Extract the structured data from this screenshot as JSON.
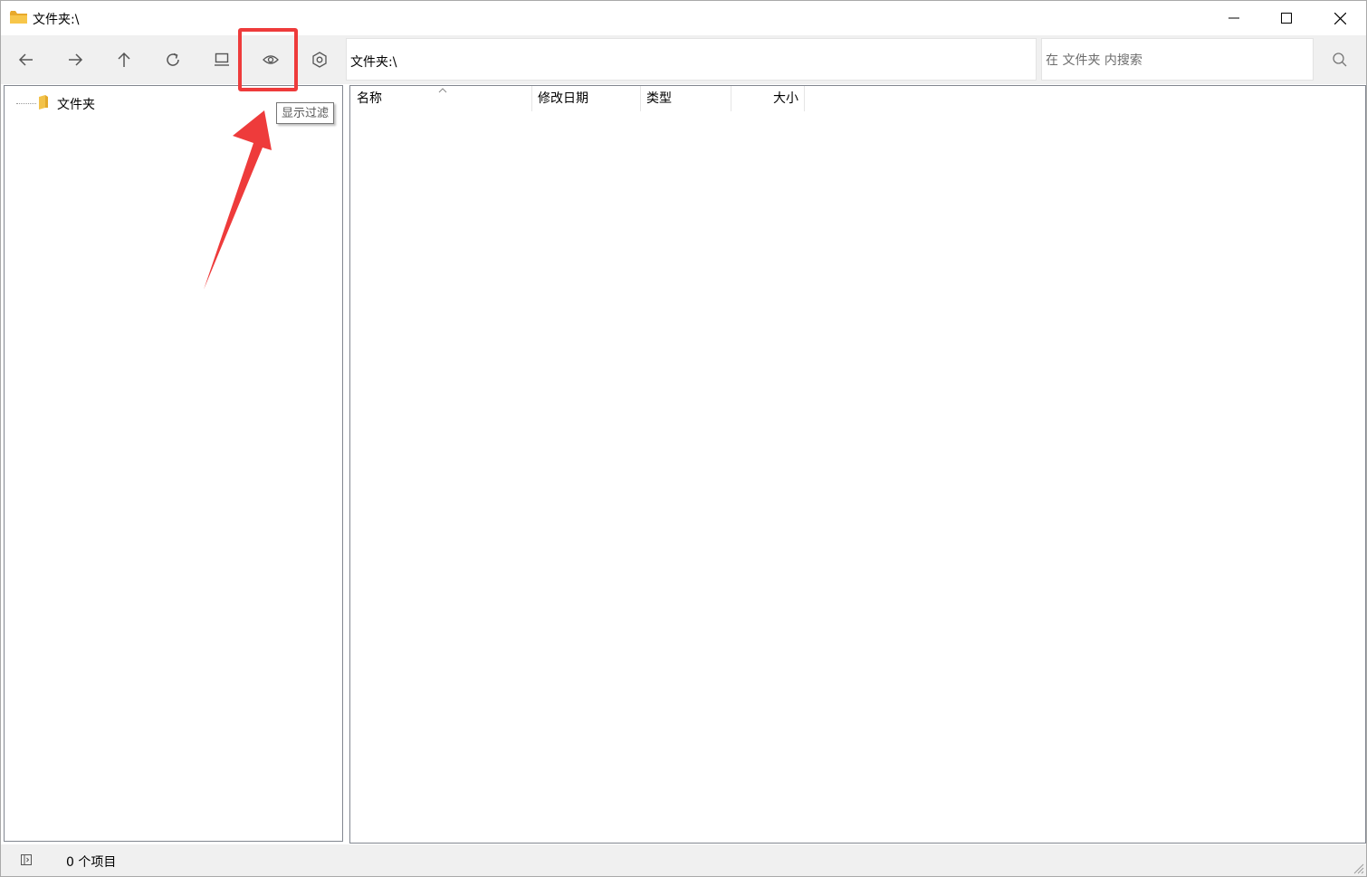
{
  "window": {
    "title": "文件夹:\\",
    "controls": [
      "minimize",
      "maximize",
      "close"
    ]
  },
  "toolbar": {
    "buttons": [
      {
        "icon": "back-arrow-icon",
        "label": ""
      },
      {
        "icon": "forward-arrow-icon",
        "label": ""
      },
      {
        "icon": "up-arrow-icon",
        "label": ""
      },
      {
        "icon": "refresh-icon",
        "label": ""
      },
      {
        "icon": "view-icon",
        "label": ""
      },
      {
        "icon": "eye-icon",
        "label": ""
      },
      {
        "icon": "settings-hex-icon",
        "label": ""
      }
    ],
    "address": "文件夹:\\",
    "search_placeholder": "在 文件夹 内搜索",
    "tooltip": "显示过滤"
  },
  "tree": {
    "items": [
      {
        "label": "文件夹"
      }
    ]
  },
  "list": {
    "columns": {
      "name": "名称",
      "date": "修改日期",
      "type": "类型",
      "size": "大小"
    },
    "sort_column": "name",
    "rows": []
  },
  "status": {
    "text": "0 个项目"
  },
  "colors": {
    "highlight": "#ee3b3b",
    "toolbar_bg": "#f0f0f0",
    "folder": "#f5c33b"
  }
}
